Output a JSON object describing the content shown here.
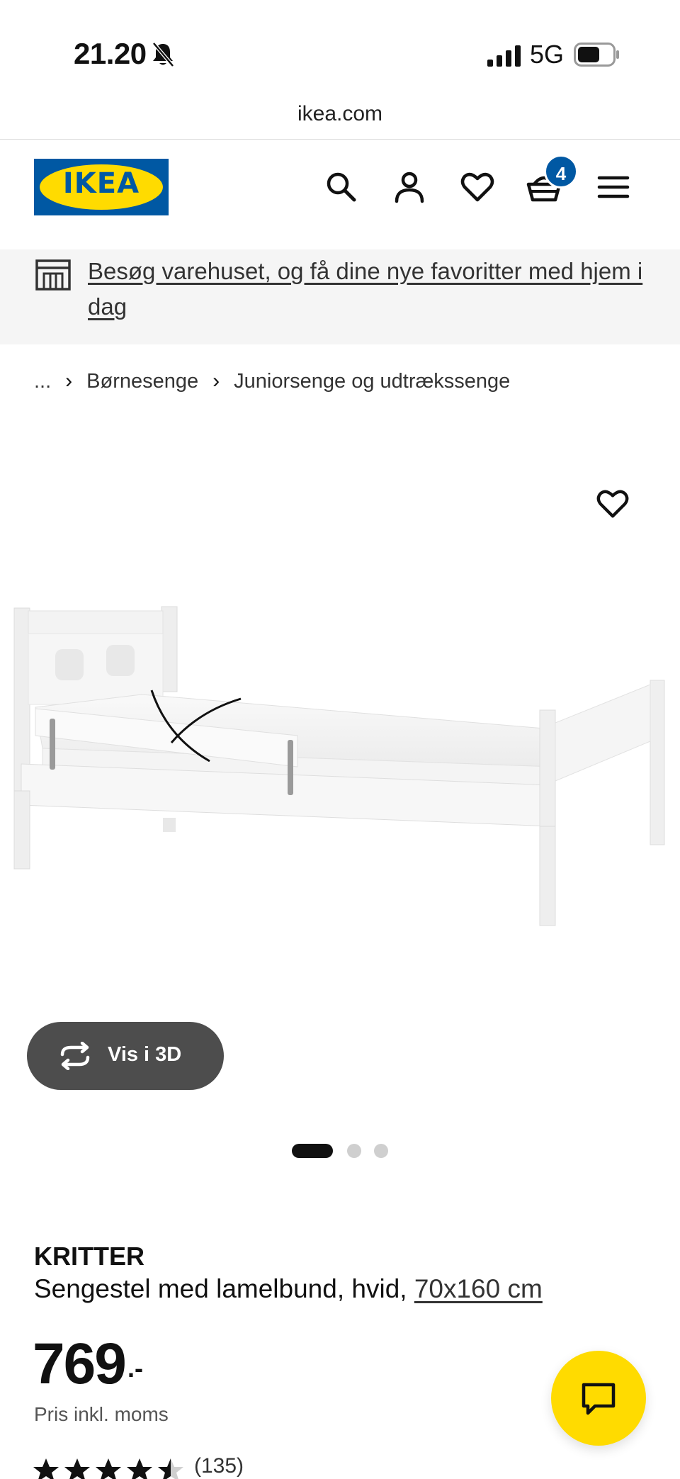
{
  "status_bar": {
    "time": "21.20",
    "network": "5G",
    "url": "ikea.com"
  },
  "header": {
    "logo_text": "IKEA",
    "cart_count": "4",
    "icons": [
      "search-icon",
      "account-icon",
      "heart-icon",
      "basket-icon",
      "menu-icon"
    ]
  },
  "banner": {
    "text": "Besøg varehuset, og få dine nye favoritter med hjem i dag"
  },
  "breadcrumb": {
    "items": [
      "...",
      "Børnesenge",
      "Juniorsenge og udtrækssenge"
    ]
  },
  "gallery": {
    "view_3d_label": "Vis i 3D",
    "slide_count": 3,
    "active_slide": 1
  },
  "product": {
    "name": "KRITTER",
    "description": "Sengestel med lamelbund, hvid,",
    "size_link": "70x160 cm",
    "price": "769",
    "price_suffix": ".-",
    "vat_note": "Pris inkl. moms",
    "rating": 4.5,
    "review_count": "(135)"
  },
  "colors": {
    "ikea_blue": "#0058a3",
    "ikea_yellow": "#ffdb00",
    "banner_bg": "#f5f5f5",
    "view3d_bg": "#4d4d4d"
  }
}
